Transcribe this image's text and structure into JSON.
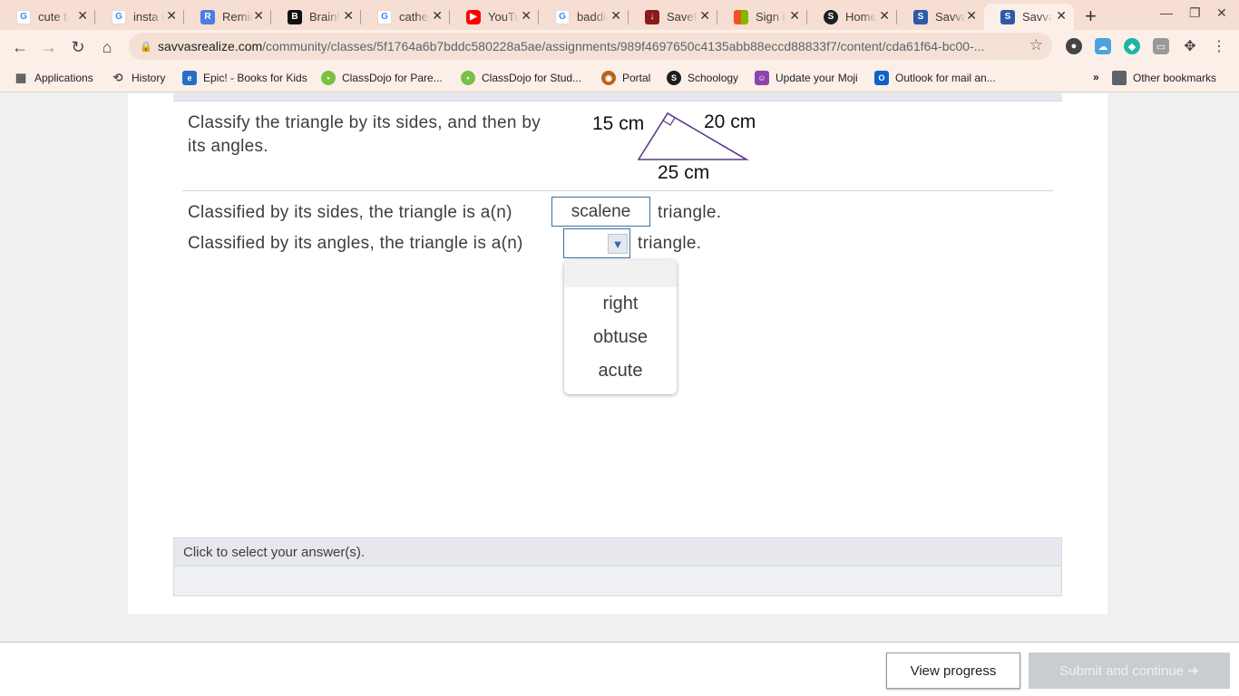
{
  "browser": {
    "tabs": [
      {
        "title": "cute te",
        "icon": "google-icon"
      },
      {
        "title": "insta t",
        "icon": "google-icon"
      },
      {
        "title": "Remin",
        "icon": "remind-icon"
      },
      {
        "title": "Brainly",
        "icon": "brainly-icon"
      },
      {
        "title": "cather",
        "icon": "google-icon"
      },
      {
        "title": "YouTu",
        "icon": "youtube-icon"
      },
      {
        "title": "baddie",
        "icon": "google-icon"
      },
      {
        "title": "SaveF",
        "icon": "savefrom-icon"
      },
      {
        "title": "Sign in",
        "icon": "microsoft-icon"
      },
      {
        "title": "Home",
        "icon": "schoology-icon"
      },
      {
        "title": "Savva",
        "icon": "savvas-icon"
      },
      {
        "title": "Savva",
        "icon": "savvas-icon",
        "active": true
      }
    ],
    "url_domain": "savvasrealize.com",
    "url_path": "/community/classes/5f1764a6b7bddc580228a5ae/assignments/989f4697650c4135abb88eccd88833f7/content/cda61f64-bc00-...",
    "bookmarks": [
      {
        "label": "Applications",
        "icon": "apps-icon"
      },
      {
        "label": "History",
        "icon": "history-icon"
      },
      {
        "label": "Epic! - Books for Kids",
        "icon": "epic-icon"
      },
      {
        "label": "ClassDojo for Pare...",
        "icon": "classdojo-icon"
      },
      {
        "label": "ClassDojo for Stud...",
        "icon": "classdojo-icon"
      },
      {
        "label": "Portal",
        "icon": "portal-icon"
      },
      {
        "label": "Schoology",
        "icon": "schoology-icon"
      },
      {
        "label": "Update your Moji",
        "icon": "moji-icon"
      },
      {
        "label": "Outlook for mail an...",
        "icon": "outlook-icon"
      }
    ],
    "other_bookmarks": "Other bookmarks",
    "overflow": "»"
  },
  "question": {
    "prompt": "Classify the triangle by its sides, and then by its angles.",
    "diagram": {
      "side_left": "15 cm",
      "side_right": "20 cm",
      "side_bottom": "25 cm"
    },
    "line1_prefix": "Classified by its sides, the triangle is a(n)",
    "line1_answer": "scalene",
    "line1_suffix": "triangle.",
    "line2_prefix": "Classified by its angles, the triangle is a(n)",
    "line2_answer": "",
    "line2_suffix": "triangle.",
    "dropdown_options": [
      "",
      "right",
      "obtuse",
      "acute"
    ]
  },
  "hint": "Click to select your answer(s).",
  "footer": {
    "view_progress": "View progress",
    "submit": "Submit and continue ➔"
  },
  "colors": {
    "tabstrip": "#f6ded2",
    "toolbar": "#fcefe8",
    "input_border": "#3b6fa3",
    "triangle_stroke": "#5b3a8c",
    "submit_disabled": "#c9ccd1"
  }
}
